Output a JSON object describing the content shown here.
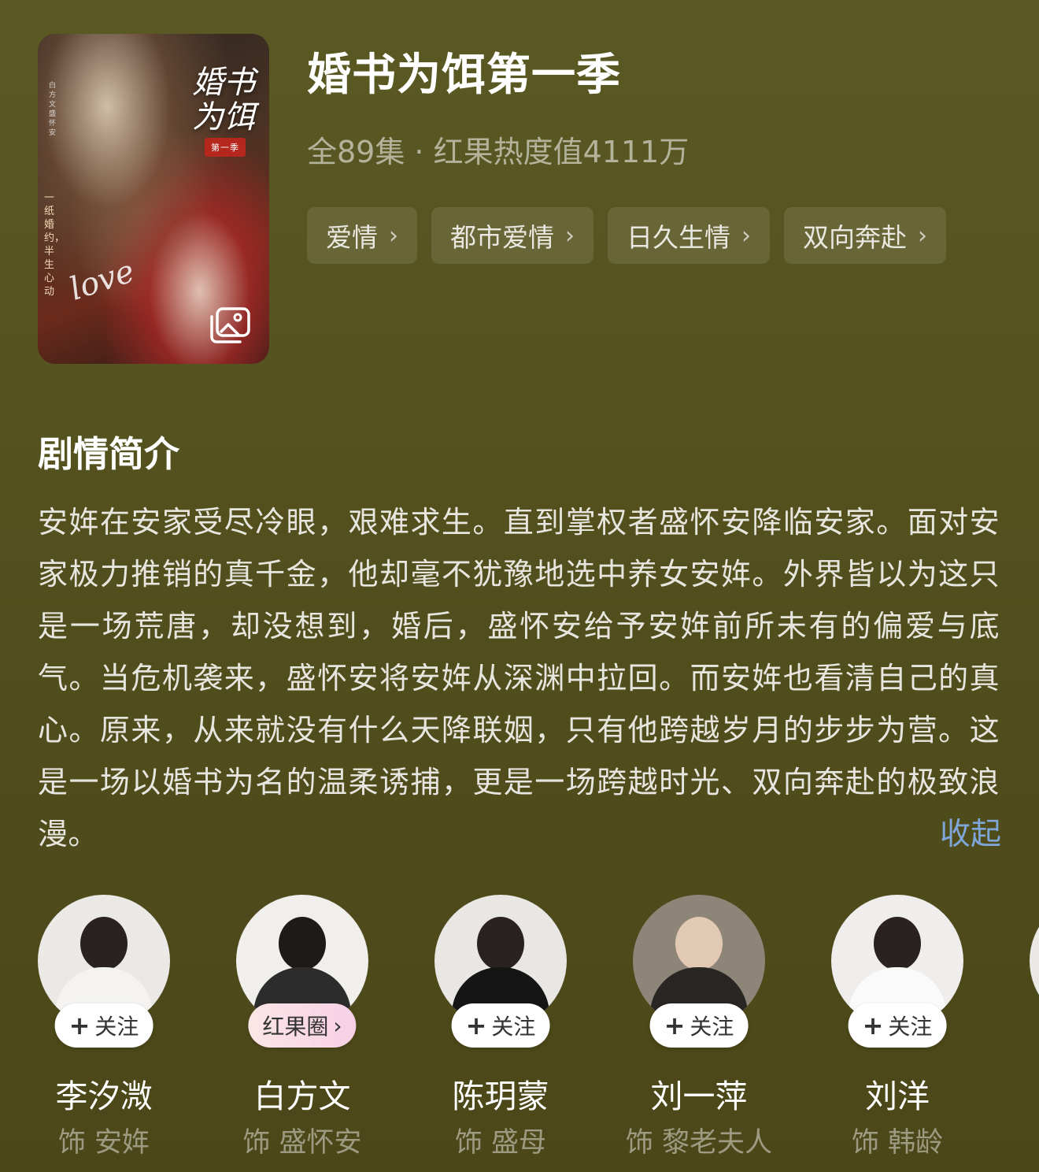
{
  "show": {
    "title": "婚书为饵第一季",
    "meta": "全89集 · 红果热度值4111万",
    "poster": {
      "title_line": "婚书为饵",
      "season_badge": "第一季",
      "script_word": "love",
      "tagline": "一纸婚约，半生心动",
      "names_left": "白方文 盛怀安",
      "icon": "gallery-icon"
    }
  },
  "tags": [
    {
      "label": "爱情",
      "icon": "chevron-right-icon"
    },
    {
      "label": "都市爱情",
      "icon": "chevron-right-icon"
    },
    {
      "label": "日久生情",
      "icon": "chevron-right-icon"
    },
    {
      "label": "双向奔赴",
      "icon": "chevron-right-icon"
    }
  ],
  "synopsis": {
    "heading": "剧情简介",
    "text": "安姩在安家受尽冷眼，艰难求生。直到掌权者盛怀安降临安家。面对安家极力推销的真千金，他却毫不犹豫地选中养女安姩。外界皆以为这只是一场荒唐，却没想到，婚后，盛怀安给予安姩前所未有的偏爱与底气。当危机袭来，盛怀安将安姩从深渊中拉回。而安姩也看清自己的真心。原来，从来就没有什么天降联姻，只有他跨越岁月的步步为营。这是一场以婚书为名的温柔诱捕，更是一场跨越时光、双向奔赴的极致浪漫。",
    "collapse_label": "收起"
  },
  "cast": [
    {
      "name": "李汐溦",
      "role": "饰 安姩",
      "badge": "关注",
      "badge_icon": "plus-icon"
    },
    {
      "name": "白方文",
      "role": "饰 盛怀安",
      "badge": "红果圈",
      "badge_icon": "chevron-right-icon"
    },
    {
      "name": "陈玥蒙",
      "role": "饰 盛母",
      "badge": "关注",
      "badge_icon": "plus-icon"
    },
    {
      "name": "刘一萍",
      "role": "饰 黎老夫人",
      "badge": "关注",
      "badge_icon": "plus-icon"
    },
    {
      "name": "刘洋",
      "role": "饰 韩龄",
      "badge": "关注",
      "badge_icon": "plus-icon"
    }
  ],
  "colors": {
    "background": "#54511f",
    "link": "#7fa6d8"
  }
}
